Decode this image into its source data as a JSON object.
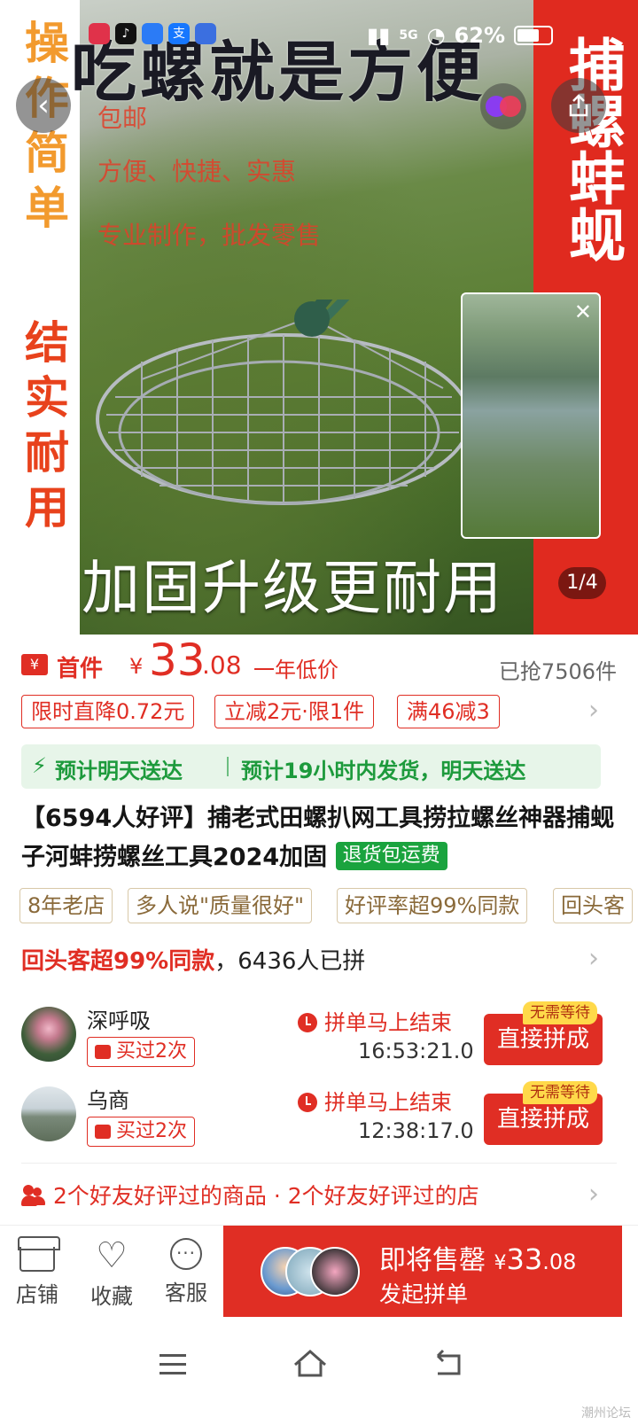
{
  "status_bar": {
    "network": "5G",
    "battery": "62%"
  },
  "hero": {
    "left_text_top": "操作简单",
    "left_text_bottom": "结实耐用",
    "right_text": "捕螺蚌蚬",
    "title": "吃螺就是方便",
    "promo_lines": [
      "包邮",
      "方便、快捷、实惠",
      "专业制作，批发零售"
    ],
    "caption": "加固升级更耐用",
    "counter": "1/4"
  },
  "price": {
    "yen_box": "¥",
    "label": "首件",
    "currency": "¥",
    "integer": "33",
    "decimal": ".08",
    "tag": "一年低价",
    "sold": "已抢7506件"
  },
  "coupons": [
    "限时直降0.72元",
    "立减2元·限1件",
    "满46减3"
  ],
  "delivery": {
    "primary": "预计明天送达",
    "secondary": "预计19小时内发货，明天送达"
  },
  "product": {
    "title": "【6594人好评】捕老式田螺扒网工具捞拉螺丝神器捕蚬子河蚌捞螺丝工具2024加固",
    "badge": "退货包运费"
  },
  "tags": [
    "8年老店",
    "多人说\"质量很好\"",
    "好评率超99%同款",
    "回头客"
  ],
  "repeat": {
    "highlight": "回头客超99%同款",
    "rest": "，6436人已拼"
  },
  "groups": [
    {
      "name": "深呼吸",
      "bought": "买过2次",
      "status": "拼单马上结束",
      "timer": "16:53:21.0",
      "button": "直接拼成",
      "badge": "无需等待"
    },
    {
      "name": "乌商",
      "bought": "买过2次",
      "status": "拼单马上结束",
      "timer": "12:38:17.0",
      "button": "直接拼成",
      "badge": "无需等待"
    }
  ],
  "friends": "2个好友好评过的商品 · 2个好友好评过的店",
  "action_bar": {
    "store": "店铺",
    "favorite": "收藏",
    "service": "客服",
    "buy_line1": "即将售罄",
    "buy_currency": "¥",
    "buy_price_int": "33",
    "buy_price_dec": ".08",
    "buy_line2": "发起拼单"
  },
  "watermark": "潮州论坛",
  "colors": {
    "accent": "#e02e24",
    "delivery_green": "#1d9a3c",
    "badge_green": "#1aa33e"
  }
}
